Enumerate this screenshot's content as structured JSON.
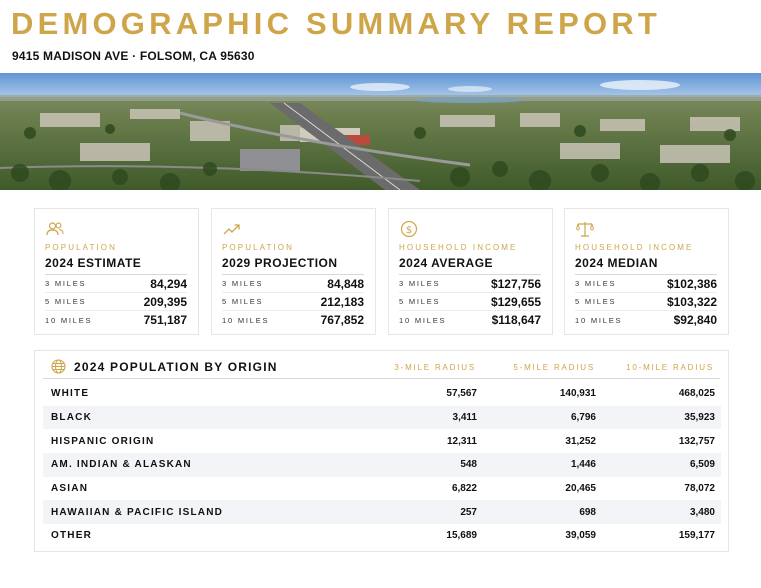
{
  "header": {
    "title": "DEMOGRAPHIC SUMMARY REPORT",
    "address": "9415 MADISON AVE · FOLSOM, CA 95630"
  },
  "colors": {
    "accent": "#CFA54A",
    "text": "#111111",
    "row_alt": "#f2f4f7"
  },
  "cards": [
    {
      "icon": "people-icon",
      "category": "POPULATION",
      "title": "2024 ESTIMATE",
      "rows": [
        {
          "label": "3 MILES",
          "value": "84,294"
        },
        {
          "label": "5 MILES",
          "value": "209,395"
        },
        {
          "label": "10 MILES",
          "value": "751,187"
        }
      ]
    },
    {
      "icon": "trend-up-icon",
      "category": "POPULATION",
      "title": "2029 PROJECTION",
      "rows": [
        {
          "label": "3 MILES",
          "value": "84,848"
        },
        {
          "label": "5 MILES",
          "value": "212,183"
        },
        {
          "label": "10 MILES",
          "value": "767,852"
        }
      ]
    },
    {
      "icon": "dollar-icon",
      "category": "HOUSEHOLD INCOME",
      "title": "2024 AVERAGE",
      "rows": [
        {
          "label": "3 MILES",
          "value": "$127,756"
        },
        {
          "label": "5 MILES",
          "value": "$129,655"
        },
        {
          "label": "10 MILES",
          "value": "$118,647"
        }
      ]
    },
    {
      "icon": "scale-icon",
      "category": "HOUSEHOLD INCOME",
      "title": "2024 MEDIAN",
      "rows": [
        {
          "label": "3 MILES",
          "value": "$102,386"
        },
        {
          "label": "5 MILES",
          "value": "$103,322"
        },
        {
          "label": "10 MILES",
          "value": "$92,840"
        }
      ]
    }
  ],
  "origin_table": {
    "icon": "globe-icon",
    "title": "2024 POPULATION BY ORIGIN",
    "columns": [
      "3-MILE RADIUS",
      "5-MILE RADIUS",
      "10-MILE RADIUS"
    ],
    "rows": [
      {
        "label": "WHITE",
        "values": [
          "57,567",
          "140,931",
          "468,025"
        ]
      },
      {
        "label": "BLACK",
        "values": [
          "3,411",
          "6,796",
          "35,923"
        ]
      },
      {
        "label": "HISPANIC ORIGIN",
        "values": [
          "12,311",
          "31,252",
          "132,757"
        ]
      },
      {
        "label": "AM. INDIAN & ALASKAN",
        "values": [
          "548",
          "1,446",
          "6,509"
        ]
      },
      {
        "label": "ASIAN",
        "values": [
          "6,822",
          "20,465",
          "78,072"
        ]
      },
      {
        "label": "HAWAIIAN & PACIFIC ISLAND",
        "values": [
          "257",
          "698",
          "3,480"
        ]
      },
      {
        "label": "OTHER",
        "values": [
          "15,689",
          "39,059",
          "159,177"
        ]
      }
    ]
  }
}
